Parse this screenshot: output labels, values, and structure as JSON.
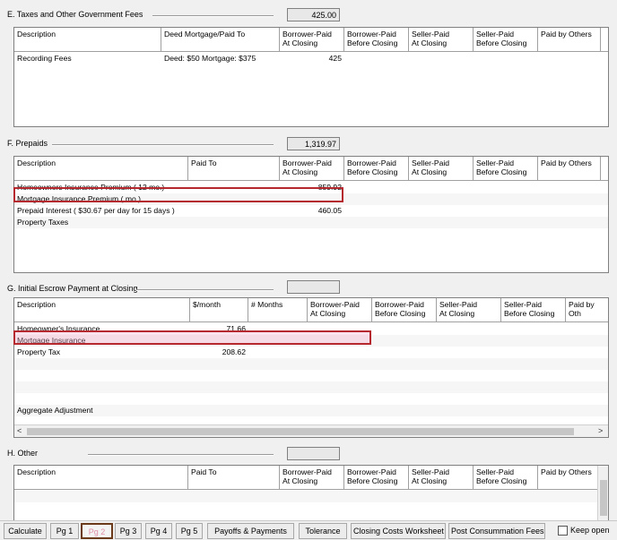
{
  "columns": {
    "description": "Description",
    "deed_mortgage_paid_to": "Deed Mortgage/Paid To",
    "paid_to": "Paid To",
    "per_month": "$/month",
    "months": "# Months",
    "borrower_at_closing": [
      "Borrower-Paid",
      "At Closing"
    ],
    "borrower_before_closing": [
      "Borrower-Paid",
      "Before Closing"
    ],
    "seller_at_closing": [
      "Seller-Paid",
      "At Closing"
    ],
    "seller_before_closing": [
      "Seller-Paid",
      "Before Closing"
    ],
    "paid_by_others": "Paid by Others",
    "paid_by_others_cut": "Paid by Oth"
  },
  "section_e": {
    "title": "E. Taxes and Other Government Fees",
    "total": "425.00",
    "rows": [
      {
        "description": "Recording Fees",
        "paid_to": "Deed: $50 Mortgage: $375",
        "borrower_at_closing": "425"
      }
    ]
  },
  "section_f": {
    "title": "F. Prepaids",
    "total": "1,319.97",
    "rows": [
      {
        "description": "Homeowners Insurance Premium ( 12 mo.)",
        "borrower_at_closing": "859.92"
      },
      {
        "description": "Mortgage Insurance Premium (  mo.)",
        "borrower_at_closing": ""
      },
      {
        "description": "Prepaid Interest ( $30.67 per day for 15 days )",
        "borrower_at_closing": "460.05"
      },
      {
        "description": "Property Taxes",
        "borrower_at_closing": ""
      }
    ]
  },
  "section_g": {
    "title": "G. Initial Escrow Payment at Closing",
    "total": "",
    "rows": [
      {
        "description": "Homeowner's Insurance",
        "per_month": "71.66"
      },
      {
        "description": "Mortgage Insurance",
        "per_month": ""
      },
      {
        "description": "Property Tax",
        "per_month": "208.62"
      }
    ],
    "aggregate_label": "Aggregate Adjustment"
  },
  "section_h": {
    "title": "H. Other",
    "total": ""
  },
  "scroll": {
    "left_arrow": "<",
    "right_arrow": ">"
  },
  "toolbar": {
    "calculate": "Calculate",
    "pg1": "Pg 1",
    "pg2": "Pg 2",
    "pg3": "Pg 3",
    "pg4": "Pg 4",
    "pg5": "Pg 5",
    "payoffs": "Payoffs & Payments",
    "tolerance": "Tolerance",
    "closing_costs_worksheet": "Closing Costs Worksheet",
    "post_consummation_fees": "Post Consummation Fees",
    "keep_open": "Keep open"
  },
  "colors": {
    "highlight_border": "#b5282e",
    "active_tab_text": "#e08fa5",
    "active_tab_border": "#6b3a1a"
  }
}
